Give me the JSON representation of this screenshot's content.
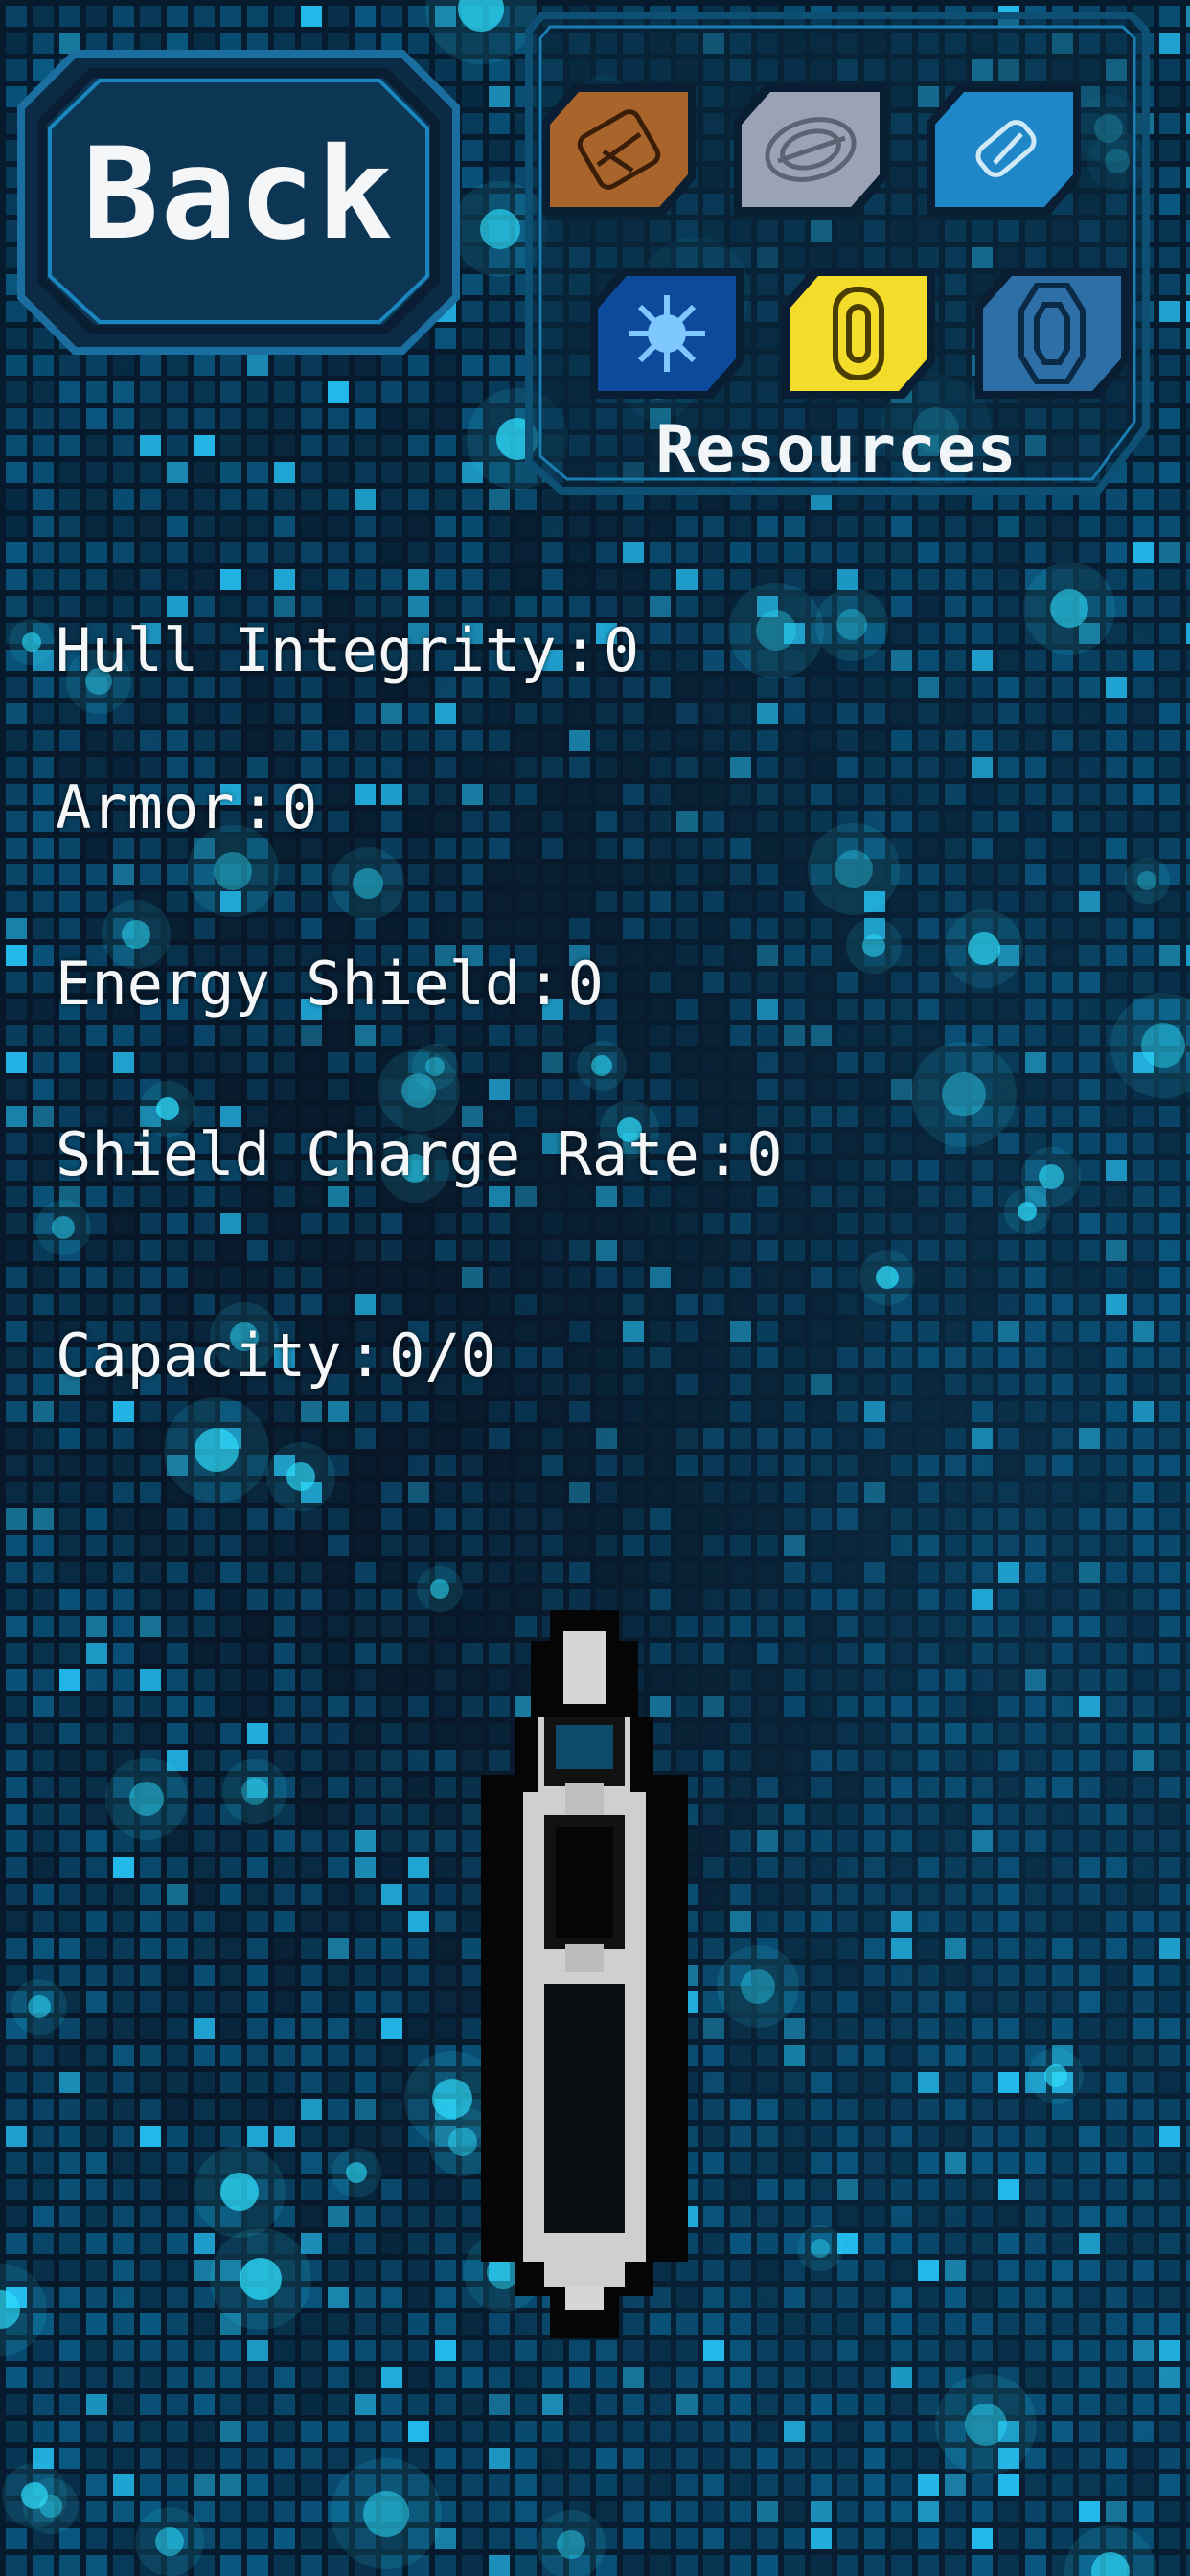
{
  "back_button": {
    "label": "Back"
  },
  "resources": {
    "label": "Resources",
    "items": [
      {
        "name": "copper-ore",
        "icon": "copper-ore-icon",
        "color": "#a8642a"
      },
      {
        "name": "iron-ore",
        "icon": "iron-ore-icon",
        "color": "#9aa3b3"
      },
      {
        "name": "silicon",
        "icon": "silicon-icon",
        "color": "#1f86c8"
      },
      {
        "name": "plasma",
        "icon": "plasma-icon",
        "color": "#0e4a9c"
      },
      {
        "name": "gold",
        "icon": "gold-icon",
        "color": "#f4dc2a"
      },
      {
        "name": "crystal",
        "icon": "crystal-icon",
        "color": "#2f6fa8"
      }
    ]
  },
  "stats": [
    {
      "label": "Hull Integrity",
      "value": "0"
    },
    {
      "label": "Armor",
      "value": "0"
    },
    {
      "label": "Energy Shield",
      "value": "0"
    },
    {
      "label": "Shield Charge Rate",
      "value": "0"
    },
    {
      "label": "Capacity",
      "value": "0/0"
    }
  ],
  "colors": {
    "background": "#071b2e",
    "grid_cell": "#0b6fa0",
    "grid_glow": "#2ee0ff",
    "panel_fill": "#0c3550",
    "panel_border": "#1c86bd",
    "text": "#f4f6f8"
  }
}
